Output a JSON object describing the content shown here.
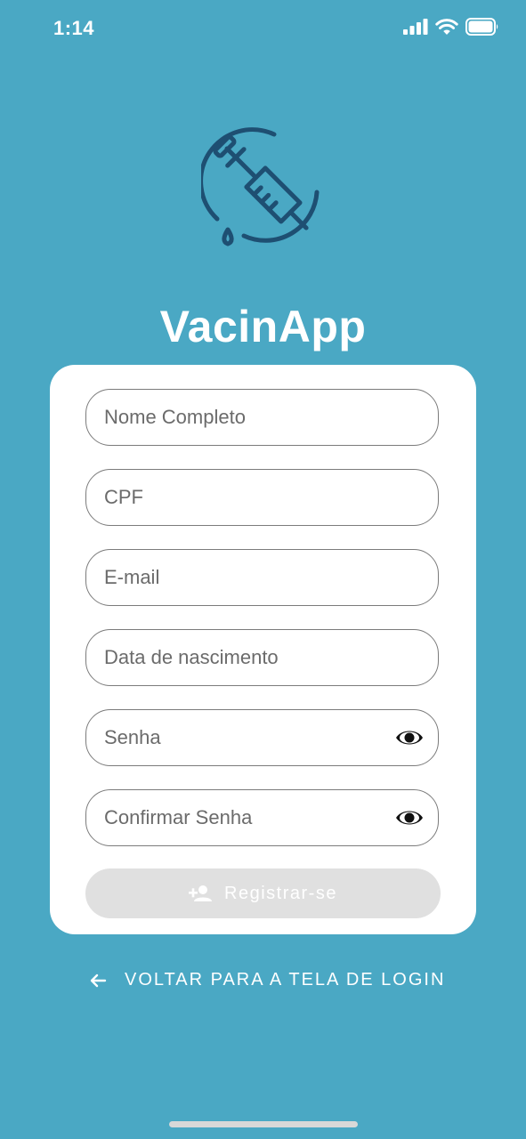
{
  "status_bar": {
    "time": "1:14",
    "icons": [
      "signal-icon",
      "wifi-icon",
      "battery-icon"
    ]
  },
  "app": {
    "title": "VacinApp",
    "logo_icon": "syringe-icon"
  },
  "form": {
    "full_name_placeholder": "Nome Completo",
    "cpf_placeholder": "CPF",
    "email_placeholder": "E-mail",
    "birthdate_placeholder": "Data de nascimento",
    "password_placeholder": "Senha",
    "confirm_password_placeholder": "Confirmar Senha",
    "register_label": "Registrar-se"
  },
  "back_link": {
    "label": "VOLTAR PARA A TELA DE LOGIN"
  },
  "colors": {
    "background": "#4aa8c4",
    "logo_stroke": "#1e4f72",
    "card": "#ffffff",
    "button_disabled": "#e0e0e0"
  }
}
